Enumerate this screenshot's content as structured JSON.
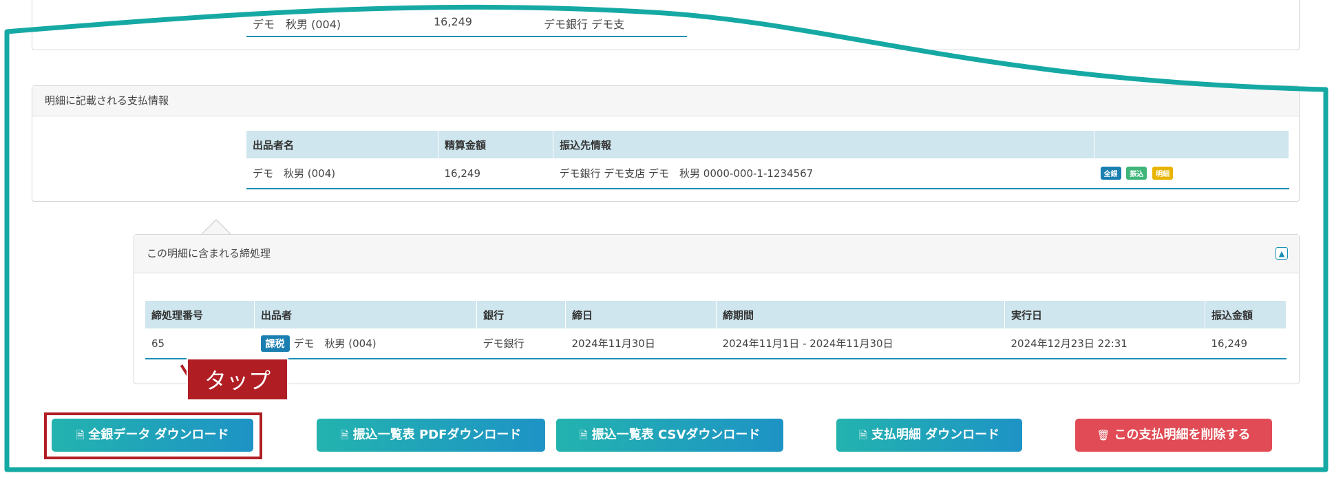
{
  "top_fragment": {
    "seller": "デモ　秋男 (004)",
    "amount": "16,249",
    "bank_partial": "デモ銀行 デモ支"
  },
  "payment_panel": {
    "title": "明細に記載される支払情報",
    "columns": [
      "出品者名",
      "精算金額",
      "振込先情報",
      ""
    ],
    "row": {
      "seller": "デモ　秋男 (004)",
      "amount": "16,249",
      "bank_info": "デモ銀行 デモ支店 デモ　秋男 0000-000-1-1234567",
      "tags": [
        {
          "label": "全銀",
          "color": "#1a7fb0"
        },
        {
          "label": "振込",
          "color": "#3fb57a"
        },
        {
          "label": "明細",
          "color": "#e8b400"
        }
      ]
    }
  },
  "closing_panel": {
    "title": "この明細に含まれる締処理",
    "columns": [
      "締処理番号",
      "出品者",
      "銀行",
      "締日",
      "締期間",
      "実行日",
      "振込金額"
    ],
    "row": {
      "id": "65",
      "badge": "課税",
      "seller": "デモ　秋男 (004)",
      "bank": "デモ銀行",
      "close_date": "2024年11月30日",
      "period": "2024年11月1日 - 2024年11月30日",
      "exec_date": "2024年12月23日 22:31",
      "amount": "16,249"
    }
  },
  "buttons": {
    "zengin": "全銀データ ダウンロード",
    "pdf": "振込一覧表 PDFダウンロード",
    "csv": "振込一覧表 CSVダウンロード",
    "statement": "支払明細 ダウンロード",
    "delete": "この支払明細を削除する"
  },
  "annotation": {
    "tap_label": "タップ"
  },
  "colors": {
    "frame": "#16a9a4",
    "accent": "#1a8fb5",
    "header_bg": "#cfe6ee",
    "danger": "#e04b55",
    "annotation": "#b01e24"
  }
}
